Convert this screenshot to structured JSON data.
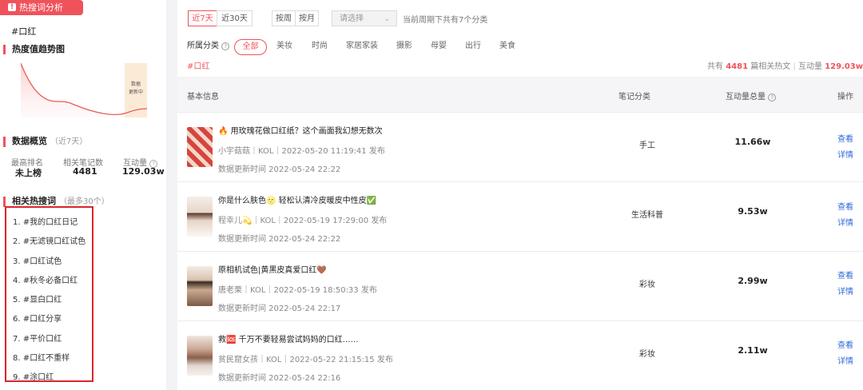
{
  "left": {
    "tag_label": "热搜词分析",
    "keyword": "#口红",
    "trend_title": "热度值趋势图",
    "updating_label_1": "数据",
    "updating_label_2": "更新中",
    "overview_title": "数据概览",
    "overview_sub": "（近7天）",
    "stats": [
      {
        "label": "最高排名",
        "value": "未上榜"
      },
      {
        "label": "相关笔记数",
        "value": "4481"
      },
      {
        "label": "互动量",
        "value": "129.03w"
      }
    ],
    "related_title": "相关热搜词",
    "related_sub": "（最多30个）",
    "related_items": [
      "1. #我的口红日记",
      "2. #无滤镜口红试色",
      "3. #口红试色",
      "4. #秋冬必备口红",
      "5. #显白口红",
      "6. #口红分享",
      "7. #平价口红",
      "8. #口红不重样",
      "9. #涂口红"
    ]
  },
  "filter": {
    "period_7": "近7天",
    "period_30": "近30天",
    "by_week": "按周",
    "by_month": "按月",
    "select_placeholder": "请选择",
    "period_note": "当前周期下共有7个分类",
    "category_label": "所属分类",
    "categories": [
      "全部",
      "美妆",
      "时尚",
      "家居家装",
      "摄影",
      "母婴",
      "出行",
      "美食"
    ],
    "keyword_tag": "#口红",
    "summary_prefix": "共有",
    "summary_count": "4481",
    "summary_mid": "篇相关热文",
    "summary_sep": "|",
    "summary_inter_label": "互动量",
    "summary_inter_value": "129.03w"
  },
  "table": {
    "headers": [
      "基本信息",
      "笔记分类",
      "互动量总量",
      "操作"
    ],
    "rows": [
      {
        "title": "🔥 用玫瑰花做口红纸？这个画面我幻想无数次",
        "meta": "小宇菇菇｜KOL｜2022-05-20 11:19:41 发布",
        "updated": "数据更新时间  2022-05-24 22:22",
        "category": "手工",
        "interaction": "11.66w",
        "action_1": "查看",
        "action_2": "详情"
      },
      {
        "title": "你是什么肤色🌝 轻松认清冷皮暖皮中性皮✅",
        "meta": "程幸儿💫｜KOL｜2022-05-19 17:29:00 发布",
        "updated": "数据更新时间  2022-05-24 22:22",
        "category": "生活科普",
        "interaction": "9.53w",
        "action_1": "查看",
        "action_2": "详情"
      },
      {
        "title": "原相机试色|黄黑皮真爱口红🤎",
        "meta": "唐老栗｜KOL｜2022-05-19 18:50:33 发布",
        "updated": "数据更新时间  2022-05-24 22:17",
        "category": "彩妆",
        "interaction": "2.99w",
        "action_1": "查看",
        "action_2": "详情"
      },
      {
        "title": "救🆘 千万不要轻易尝试妈妈的口红……",
        "meta": "贫民窟女孩｜KOL｜2022-05-22 21:15:15 发布",
        "updated": "数据更新时间  2022-05-24 22:16",
        "category": "彩妆",
        "interaction": "2.11w",
        "action_1": "查看",
        "action_2": "详情"
      }
    ]
  },
  "colors": {
    "accent": "#f0525b",
    "link": "#2f6bd9",
    "highlight_border": "#d9252c"
  },
  "icons": [
    "hot-tag-icon",
    "help-circle-icon",
    "chevron-down-icon"
  ]
}
